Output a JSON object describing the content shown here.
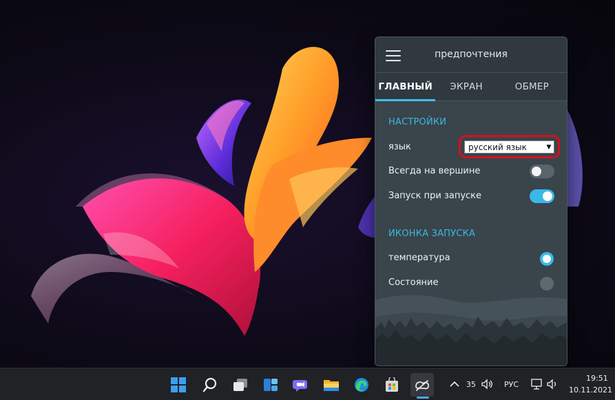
{
  "app": {
    "title": "предпочтения",
    "tabs": [
      {
        "label": "ГЛАВНЫЙ",
        "active": true
      },
      {
        "label": "ЭКРАН",
        "active": false
      },
      {
        "label": "ОБМЕР",
        "active": false
      }
    ],
    "settings": {
      "section_title": "НАСТРОЙКИ",
      "language_label": "язык",
      "language_value": "русский язык",
      "always_on_top_label": "Всегда на вершине",
      "always_on_top": false,
      "launch_at_startup_label": "Запуск при запуске",
      "launch_at_startup": true
    },
    "launch_icon": {
      "section_title": "ИКОНКА ЗАПУСКА",
      "options": [
        {
          "label": "температура",
          "selected": true
        },
        {
          "label": "Состояние",
          "selected": false
        }
      ]
    },
    "colors": {
      "accent": "#3ab8e8",
      "highlight_ring": "#d7101c",
      "panel": "#39444b"
    }
  },
  "taskbar": {
    "pinned_icons": [
      "windows-start-icon",
      "search-icon",
      "task-view-icon",
      "widgets-icon",
      "chat-icon",
      "file-explorer-icon",
      "edge-icon",
      "store-icon",
      "app-tray-icon"
    ],
    "tray": {
      "temperature": "35",
      "language": "РУС",
      "time": "19:51",
      "date": "10.11.2021"
    }
  }
}
